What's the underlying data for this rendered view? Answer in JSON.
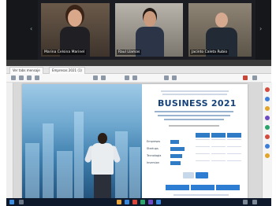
{
  "meeting": {
    "participants": [
      {
        "name": "Marina Celsina Marinel"
      },
      {
        "name": "Raul Llamas"
      },
      {
        "name": "Jacinto Caleta Rubio"
      }
    ]
  },
  "viewer": {
    "tabs": [
      "Ver tabs mensaje",
      "Empresas 2021 (1)"
    ],
    "page": {
      "headline": "BUSINESS 2021",
      "table": {
        "headers": [
          "—",
          "—",
          "—"
        ],
        "rows": [
          {
            "label": "Empresas",
            "bar_fraction": 0.35
          },
          {
            "label": "Startups",
            "bar_fraction": 0.6
          },
          {
            "label": "Tecnologia",
            "bar_fraction": 0.5
          },
          {
            "label": "Inversion",
            "bar_fraction": 0.42
          }
        ]
      }
    }
  },
  "colors": {
    "accent": "#2f7bc5",
    "headline": "#15427a",
    "taskbar": "#0e1a2b"
  }
}
